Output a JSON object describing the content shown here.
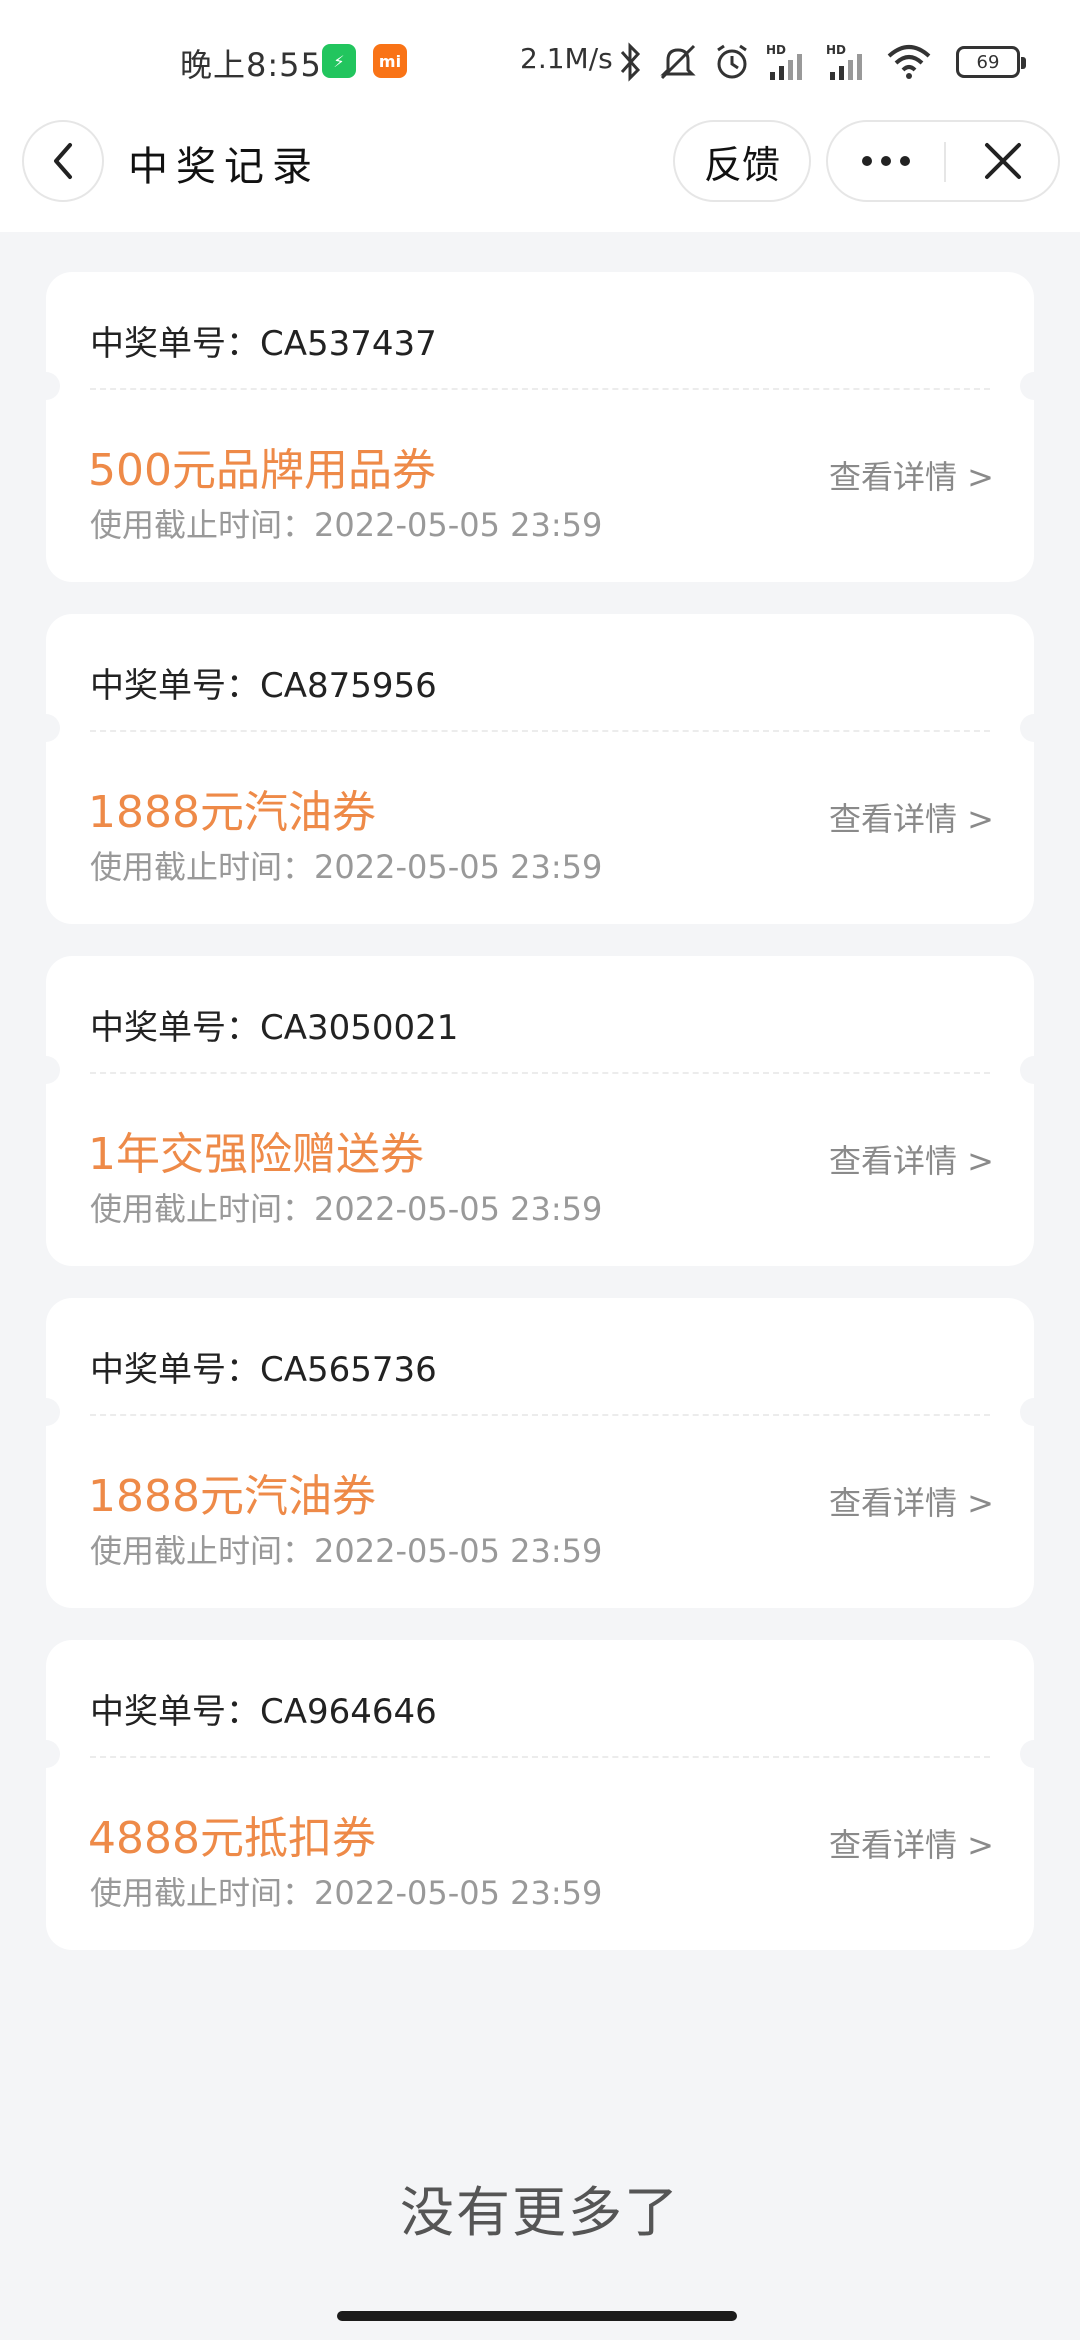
{
  "status_bar": {
    "time": "晚上8:55",
    "network_speed": "2.1M/s",
    "battery": "69",
    "icons": [
      "bluetooth-icon",
      "mute-icon",
      "alarm-icon",
      "hd-signal-icon",
      "hd-signal-icon",
      "wifi-icon"
    ]
  },
  "nav": {
    "title": "中奖记录",
    "feedback_label": "反馈"
  },
  "records": [
    {
      "order_label": "中奖单号：",
      "order_no": "CA537437",
      "prize": "500元品牌用品券",
      "deadline_label": "使用截止时间：",
      "deadline": "2022-05-05 23:59",
      "detail_label": "查看详情 >"
    },
    {
      "order_label": "中奖单号：",
      "order_no": "CA875956",
      "prize": "1888元汽油券",
      "deadline_label": "使用截止时间：",
      "deadline": "2022-05-05 23:59",
      "detail_label": "查看详情 >"
    },
    {
      "order_label": "中奖单号：",
      "order_no": "CA3050021",
      "prize": "1年交强险赠送券",
      "deadline_label": "使用截止时间：",
      "deadline": "2022-05-05 23:59",
      "detail_label": "查看详情 >"
    },
    {
      "order_label": "中奖单号：",
      "order_no": "CA565736",
      "prize": "1888元汽油券",
      "deadline_label": "使用截止时间：",
      "deadline": "2022-05-05 23:59",
      "detail_label": "查看详情 >"
    },
    {
      "order_label": "中奖单号：",
      "order_no": "CA964646",
      "prize": "4888元抵扣券",
      "deadline_label": "使用截止时间：",
      "deadline": "2022-05-05 23:59",
      "detail_label": "查看详情 >"
    }
  ],
  "footer": {
    "no_more": "没有更多了"
  },
  "colors": {
    "prize": "#ee8a48",
    "background": "#f4f5f7"
  }
}
